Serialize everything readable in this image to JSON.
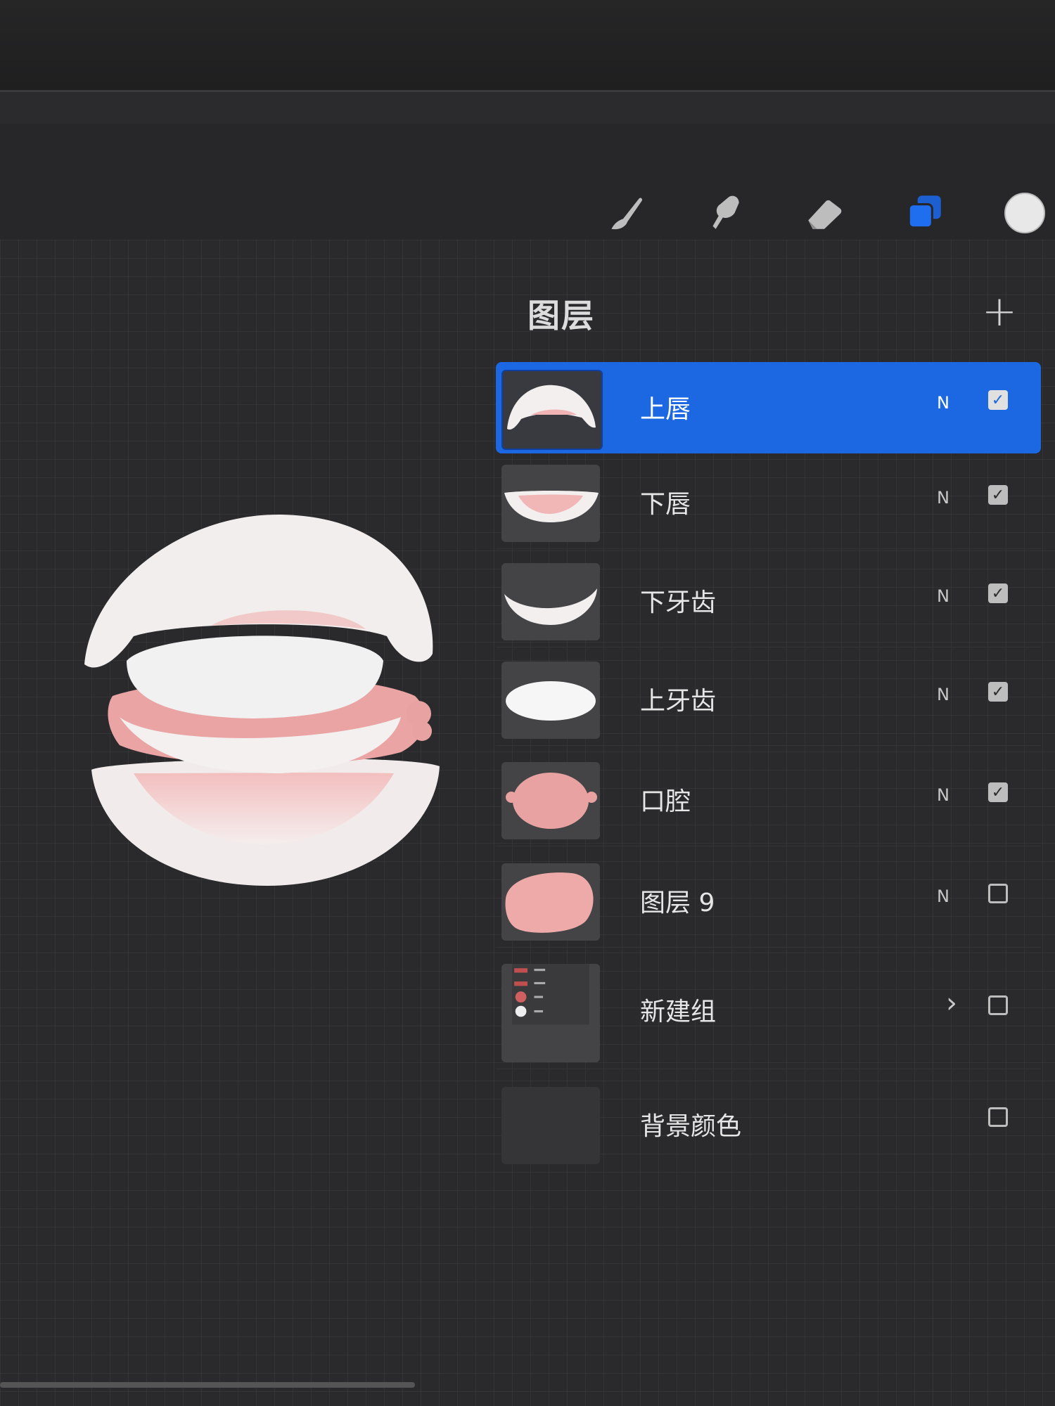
{
  "toolbar": {
    "tools": [
      {
        "name": "brush-icon",
        "active": false
      },
      {
        "name": "smudge-icon",
        "active": false
      },
      {
        "name": "eraser-icon",
        "active": false
      },
      {
        "name": "layers-icon",
        "active": true
      }
    ],
    "color": "#e8e8e8",
    "accent": "#1c68e3"
  },
  "panel": {
    "title": "图层",
    "add_label": "+",
    "layers": [
      {
        "name": "上唇",
        "blend": "N",
        "visible": true,
        "selected": true
      },
      {
        "name": "下唇",
        "blend": "N",
        "visible": true,
        "selected": false
      },
      {
        "name": "下牙齿",
        "blend": "N",
        "visible": true,
        "selected": false
      },
      {
        "name": "上牙齿",
        "blend": "N",
        "visible": true,
        "selected": false
      },
      {
        "name": "口腔",
        "blend": "N",
        "visible": true,
        "selected": false
      },
      {
        "name": "图层 9",
        "blend": "N",
        "visible": false,
        "selected": false
      },
      {
        "name": "新建组",
        "blend": "",
        "visible": false,
        "selected": false,
        "group": true
      },
      {
        "name": "背景颜色",
        "blend": "",
        "visible": false,
        "selected": false
      }
    ],
    "check_mark": "✓",
    "chevron": "›"
  }
}
